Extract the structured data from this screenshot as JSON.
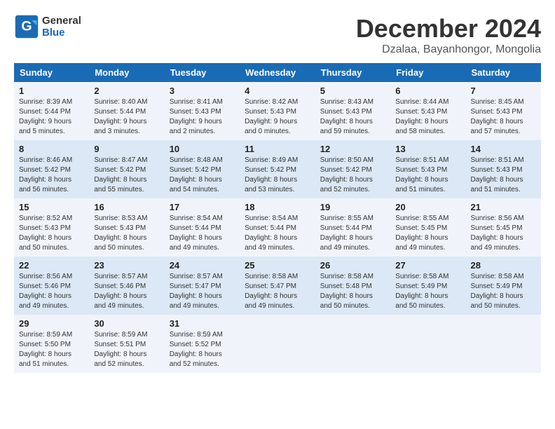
{
  "logo": {
    "text_line1": "General",
    "text_line2": "Blue"
  },
  "title": "December 2024",
  "location": "Dzalaa, Bayanhongor, Mongolia",
  "weekdays": [
    "Sunday",
    "Monday",
    "Tuesday",
    "Wednesday",
    "Thursday",
    "Friday",
    "Saturday"
  ],
  "weeks": [
    [
      {
        "day": "1",
        "info": "Sunrise: 8:39 AM\nSunset: 5:44 PM\nDaylight: 9 hours\nand 5 minutes."
      },
      {
        "day": "2",
        "info": "Sunrise: 8:40 AM\nSunset: 5:44 PM\nDaylight: 9 hours\nand 3 minutes."
      },
      {
        "day": "3",
        "info": "Sunrise: 8:41 AM\nSunset: 5:43 PM\nDaylight: 9 hours\nand 2 minutes."
      },
      {
        "day": "4",
        "info": "Sunrise: 8:42 AM\nSunset: 5:43 PM\nDaylight: 9 hours\nand 0 minutes."
      },
      {
        "day": "5",
        "info": "Sunrise: 8:43 AM\nSunset: 5:43 PM\nDaylight: 8 hours\nand 59 minutes."
      },
      {
        "day": "6",
        "info": "Sunrise: 8:44 AM\nSunset: 5:43 PM\nDaylight: 8 hours\nand 58 minutes."
      },
      {
        "day": "7",
        "info": "Sunrise: 8:45 AM\nSunset: 5:43 PM\nDaylight: 8 hours\nand 57 minutes."
      }
    ],
    [
      {
        "day": "8",
        "info": "Sunrise: 8:46 AM\nSunset: 5:42 PM\nDaylight: 8 hours\nand 56 minutes."
      },
      {
        "day": "9",
        "info": "Sunrise: 8:47 AM\nSunset: 5:42 PM\nDaylight: 8 hours\nand 55 minutes."
      },
      {
        "day": "10",
        "info": "Sunrise: 8:48 AM\nSunset: 5:42 PM\nDaylight: 8 hours\nand 54 minutes."
      },
      {
        "day": "11",
        "info": "Sunrise: 8:49 AM\nSunset: 5:42 PM\nDaylight: 8 hours\nand 53 minutes."
      },
      {
        "day": "12",
        "info": "Sunrise: 8:50 AM\nSunset: 5:42 PM\nDaylight: 8 hours\nand 52 minutes."
      },
      {
        "day": "13",
        "info": "Sunrise: 8:51 AM\nSunset: 5:43 PM\nDaylight: 8 hours\nand 51 minutes."
      },
      {
        "day": "14",
        "info": "Sunrise: 8:51 AM\nSunset: 5:43 PM\nDaylight: 8 hours\nand 51 minutes."
      }
    ],
    [
      {
        "day": "15",
        "info": "Sunrise: 8:52 AM\nSunset: 5:43 PM\nDaylight: 8 hours\nand 50 minutes."
      },
      {
        "day": "16",
        "info": "Sunrise: 8:53 AM\nSunset: 5:43 PM\nDaylight: 8 hours\nand 50 minutes."
      },
      {
        "day": "17",
        "info": "Sunrise: 8:54 AM\nSunset: 5:44 PM\nDaylight: 8 hours\nand 49 minutes."
      },
      {
        "day": "18",
        "info": "Sunrise: 8:54 AM\nSunset: 5:44 PM\nDaylight: 8 hours\nand 49 minutes."
      },
      {
        "day": "19",
        "info": "Sunrise: 8:55 AM\nSunset: 5:44 PM\nDaylight: 8 hours\nand 49 minutes."
      },
      {
        "day": "20",
        "info": "Sunrise: 8:55 AM\nSunset: 5:45 PM\nDaylight: 8 hours\nand 49 minutes."
      },
      {
        "day": "21",
        "info": "Sunrise: 8:56 AM\nSunset: 5:45 PM\nDaylight: 8 hours\nand 49 minutes."
      }
    ],
    [
      {
        "day": "22",
        "info": "Sunrise: 8:56 AM\nSunset: 5:46 PM\nDaylight: 8 hours\nand 49 minutes."
      },
      {
        "day": "23",
        "info": "Sunrise: 8:57 AM\nSunset: 5:46 PM\nDaylight: 8 hours\nand 49 minutes."
      },
      {
        "day": "24",
        "info": "Sunrise: 8:57 AM\nSunset: 5:47 PM\nDaylight: 8 hours\nand 49 minutes."
      },
      {
        "day": "25",
        "info": "Sunrise: 8:58 AM\nSunset: 5:47 PM\nDaylight: 8 hours\nand 49 minutes."
      },
      {
        "day": "26",
        "info": "Sunrise: 8:58 AM\nSunset: 5:48 PM\nDaylight: 8 hours\nand 50 minutes."
      },
      {
        "day": "27",
        "info": "Sunrise: 8:58 AM\nSunset: 5:49 PM\nDaylight: 8 hours\nand 50 minutes."
      },
      {
        "day": "28",
        "info": "Sunrise: 8:58 AM\nSunset: 5:49 PM\nDaylight: 8 hours\nand 50 minutes."
      }
    ],
    [
      {
        "day": "29",
        "info": "Sunrise: 8:59 AM\nSunset: 5:50 PM\nDaylight: 8 hours\nand 51 minutes."
      },
      {
        "day": "30",
        "info": "Sunrise: 8:59 AM\nSunset: 5:51 PM\nDaylight: 8 hours\nand 52 minutes."
      },
      {
        "day": "31",
        "info": "Sunrise: 8:59 AM\nSunset: 5:52 PM\nDaylight: 8 hours\nand 52 minutes."
      },
      null,
      null,
      null,
      null
    ]
  ]
}
